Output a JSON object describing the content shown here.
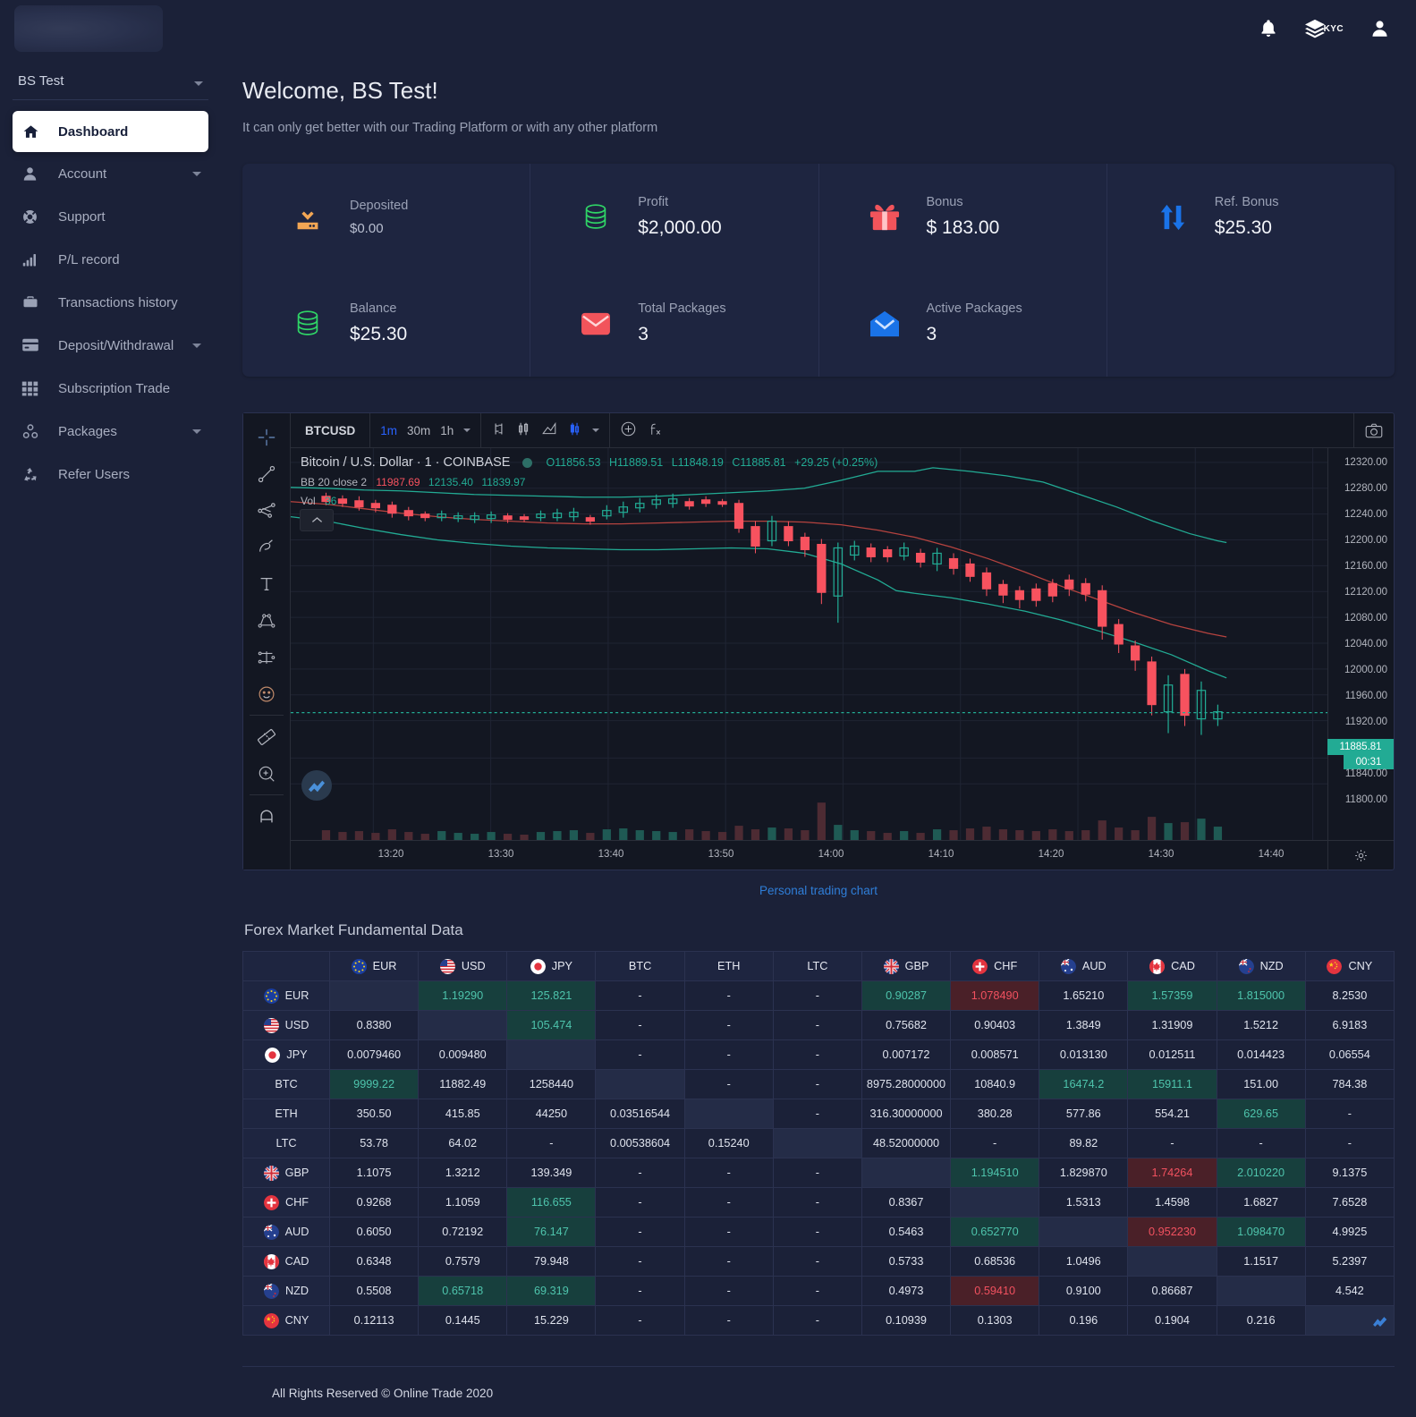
{
  "sidebar": {
    "account_name": "BS Test",
    "items": [
      {
        "label": "Dashboard",
        "icon": "home-icon",
        "active": true,
        "hasArrow": false
      },
      {
        "label": "Account",
        "icon": "user-icon",
        "active": false,
        "hasArrow": true
      },
      {
        "label": "Support",
        "icon": "lifebuoy-icon",
        "active": false,
        "hasArrow": false
      },
      {
        "label": "P/L record",
        "icon": "bar-chart-icon",
        "active": false,
        "hasArrow": false
      },
      {
        "label": "Transactions history",
        "icon": "briefcase-icon",
        "active": false,
        "hasArrow": false
      },
      {
        "label": "Deposit/Withdrawal",
        "icon": "credit-card-icon",
        "active": false,
        "hasArrow": true
      },
      {
        "label": "Subscription Trade",
        "icon": "grid-icon",
        "active": false,
        "hasArrow": false
      },
      {
        "label": "Packages",
        "icon": "packages-icon",
        "active": false,
        "hasArrow": true
      },
      {
        "label": "Refer Users",
        "icon": "recycle-icon",
        "active": false,
        "hasArrow": false
      }
    ]
  },
  "topbar": {
    "menu_icon": "hamburger-icon",
    "notification_icon": "bell-icon",
    "kyc_label": "KYC",
    "kyc_icon": "layers-icon",
    "profile_icon": "user-avatar-icon"
  },
  "header": {
    "welcome": "Welcome, BS Test!",
    "subtitle": "It can only get better with our Trading Platform or with any other platform"
  },
  "stats": [
    {
      "label": "Deposited",
      "value": "$0.00",
      "icon": "download-tray-icon",
      "color": "#f2a654"
    },
    {
      "label": "Balance",
      "value": "$25.30",
      "icon": "coins-icon",
      "color": "#2fd566"
    },
    {
      "label": "Profit",
      "value": "$2,000.00",
      "icon": "coins-icon",
      "color": "#2fd566"
    },
    {
      "label": "Total Packages",
      "value": "3",
      "icon": "envelope-icon",
      "color": "#f2545b"
    },
    {
      "label": "Bonus",
      "value": "$ 183.00",
      "icon": "gift-icon",
      "color": "#f2545b"
    },
    {
      "label": "Active Packages",
      "value": "3",
      "icon": "envelope-open-icon",
      "color": "#1a73e8"
    },
    {
      "label": "Ref. Bonus",
      "value": "$25.30",
      "icon": "repeat-icon",
      "color": "#1a73e8"
    }
  ],
  "chart": {
    "symbol": "BTCUSD",
    "resolutions": [
      "1m",
      "30m",
      "1h"
    ],
    "active_resolution": "1m",
    "toolbar_icons": [
      "compare-icon",
      "candles-icon",
      "area-icon",
      "bar-style-icon",
      "chevron-down-icon",
      "indicator-add-icon",
      "formula-icon"
    ],
    "camera_icon": "camera-icon",
    "left_tools": [
      "crosshair-icon",
      "trendline-icon",
      "pitchfork-icon",
      "brush-icon",
      "text-icon",
      "pattern-icon",
      "position-icon",
      "emoji-icon",
      "ruler-icon",
      "zoom-in-icon",
      "magnet-icon"
    ],
    "legend_title": "Bitcoin / U.S. Dollar · 1 · COINBASE",
    "ohlc": {
      "o_label": "O",
      "o": "11856.53",
      "h_label": "H",
      "h": "11889.51",
      "l_label": "L",
      "l": "11848.19",
      "c_label": "C",
      "c": "11885.81",
      "change": "+29.25 (+0.25%)"
    },
    "bb_label": "BB 20 close 2",
    "bb_v1": "11987.69",
    "bb_v2": "12135.40",
    "bb_v3": "11839.97",
    "vol_label": "Vol",
    "vol_value": "36",
    "last_price": "11885.81",
    "countdown": "00:31",
    "link": "Personal trading chart",
    "settings_icon": "gear-icon",
    "tv_logo_icon": "tradingview-logo-icon",
    "collapse_icon": "chevron-up-icon"
  },
  "chart_data": {
    "type": "line",
    "title": "Bitcoin / U.S. Dollar · 1 · COINBASE",
    "xlabel": "",
    "ylabel": "",
    "ylim": [
      11780,
      12340
    ],
    "y_ticks": [
      "12320.00",
      "12280.00",
      "12240.00",
      "12200.00",
      "12160.00",
      "12120.00",
      "12080.00",
      "12040.00",
      "12000.00",
      "11960.00",
      "11920.00",
      "11840.00",
      "11800.00"
    ],
    "x_ticks": [
      "13:20",
      "13:30",
      "13:40",
      "13:50",
      "14:00",
      "14:10",
      "14:20",
      "14:30",
      "14:40"
    ],
    "grid": true,
    "legend_position": "top-left",
    "series": [
      {
        "name": "BB upper",
        "color": "#22ab94"
      },
      {
        "name": "BB basis",
        "color": "#f7525f"
      },
      {
        "name": "BB lower",
        "color": "#22ab94"
      },
      {
        "name": "Volume",
        "color": "#22ab94/#f7525f"
      }
    ],
    "annotations": [
      {
        "label": "last price",
        "value": "11885.81"
      },
      {
        "label": "countdown",
        "value": "00:31"
      },
      {
        "label": "BB 20 close 2",
        "values": [
          "11987.69",
          "12135.40",
          "11839.97"
        ]
      },
      {
        "label": "Vol",
        "value": "36"
      }
    ]
  },
  "forex": {
    "title": "Forex Market Fundamental Data",
    "columns": [
      {
        "code": "",
        "flag": ""
      },
      {
        "code": "EUR",
        "flag": "eur"
      },
      {
        "code": "USD",
        "flag": "usd"
      },
      {
        "code": "JPY",
        "flag": "jpy"
      },
      {
        "code": "BTC",
        "flag": ""
      },
      {
        "code": "ETH",
        "flag": ""
      },
      {
        "code": "LTC",
        "flag": ""
      },
      {
        "code": "GBP",
        "flag": "gbp"
      },
      {
        "code": "CHF",
        "flag": "chf"
      },
      {
        "code": "AUD",
        "flag": "aud"
      },
      {
        "code": "CAD",
        "flag": "cad"
      },
      {
        "code": "NZD",
        "flag": "nzd"
      },
      {
        "code": "CNY",
        "flag": "cny"
      }
    ],
    "rows": [
      {
        "code": "EUR",
        "flag": "eur",
        "cells": [
          {
            "v": "",
            "s": "diag"
          },
          {
            "v": "1.19290",
            "s": "up"
          },
          {
            "v": "125.821",
            "s": "up"
          },
          {
            "v": "-",
            "s": ""
          },
          {
            "v": "-",
            "s": ""
          },
          {
            "v": "-",
            "s": ""
          },
          {
            "v": "0.90287",
            "s": "up"
          },
          {
            "v": "1.078490",
            "s": "down"
          },
          {
            "v": "1.65210",
            "s": ""
          },
          {
            "v": "1.57359",
            "s": "up"
          },
          {
            "v": "1.815000",
            "s": "up"
          },
          {
            "v": "8.2530",
            "s": ""
          }
        ]
      },
      {
        "code": "USD",
        "flag": "usd",
        "cells": [
          {
            "v": "0.8380",
            "s": ""
          },
          {
            "v": "",
            "s": "diag"
          },
          {
            "v": "105.474",
            "s": "up"
          },
          {
            "v": "-",
            "s": ""
          },
          {
            "v": "-",
            "s": ""
          },
          {
            "v": "-",
            "s": ""
          },
          {
            "v": "0.75682",
            "s": ""
          },
          {
            "v": "0.90403",
            "s": ""
          },
          {
            "v": "1.3849",
            "s": ""
          },
          {
            "v": "1.31909",
            "s": ""
          },
          {
            "v": "1.5212",
            "s": ""
          },
          {
            "v": "6.9183",
            "s": ""
          }
        ]
      },
      {
        "code": "JPY",
        "flag": "jpy",
        "cells": [
          {
            "v": "0.0079460",
            "s": ""
          },
          {
            "v": "0.009480",
            "s": ""
          },
          {
            "v": "",
            "s": "diag"
          },
          {
            "v": "-",
            "s": ""
          },
          {
            "v": "-",
            "s": ""
          },
          {
            "v": "-",
            "s": ""
          },
          {
            "v": "0.007172",
            "s": ""
          },
          {
            "v": "0.008571",
            "s": ""
          },
          {
            "v": "0.013130",
            "s": ""
          },
          {
            "v": "0.012511",
            "s": ""
          },
          {
            "v": "0.014423",
            "s": ""
          },
          {
            "v": "0.06554",
            "s": ""
          }
        ]
      },
      {
        "code": "BTC",
        "flag": "",
        "cells": [
          {
            "v": "9999.22",
            "s": "up"
          },
          {
            "v": "11882.49",
            "s": ""
          },
          {
            "v": "1258440",
            "s": ""
          },
          {
            "v": "",
            "s": "diag"
          },
          {
            "v": "-",
            "s": ""
          },
          {
            "v": "-",
            "s": ""
          },
          {
            "v": "8975.28000000",
            "s": ""
          },
          {
            "v": "10840.9",
            "s": ""
          },
          {
            "v": "16474.2",
            "s": "up"
          },
          {
            "v": "15911.1",
            "s": "up"
          },
          {
            "v": "151.00",
            "s": ""
          },
          {
            "v": "784.38",
            "s": ""
          }
        ]
      },
      {
        "code": "ETH",
        "flag": "",
        "cells": [
          {
            "v": "350.50",
            "s": ""
          },
          {
            "v": "415.85",
            "s": ""
          },
          {
            "v": "44250",
            "s": ""
          },
          {
            "v": "0.03516544",
            "s": ""
          },
          {
            "v": "",
            "s": "diag"
          },
          {
            "v": "-",
            "s": ""
          },
          {
            "v": "316.30000000",
            "s": ""
          },
          {
            "v": "380.28",
            "s": ""
          },
          {
            "v": "577.86",
            "s": ""
          },
          {
            "v": "554.21",
            "s": ""
          },
          {
            "v": "629.65",
            "s": "up"
          },
          {
            "v": "-",
            "s": ""
          }
        ]
      },
      {
        "code": "LTC",
        "flag": "",
        "cells": [
          {
            "v": "53.78",
            "s": ""
          },
          {
            "v": "64.02",
            "s": ""
          },
          {
            "v": "-",
            "s": ""
          },
          {
            "v": "0.00538604",
            "s": ""
          },
          {
            "v": "0.15240",
            "s": ""
          },
          {
            "v": "",
            "s": "diag"
          },
          {
            "v": "48.52000000",
            "s": ""
          },
          {
            "v": "-",
            "s": ""
          },
          {
            "v": "89.82",
            "s": ""
          },
          {
            "v": "-",
            "s": ""
          },
          {
            "v": "-",
            "s": ""
          },
          {
            "v": "-",
            "s": ""
          }
        ]
      },
      {
        "code": "GBP",
        "flag": "gbp",
        "cells": [
          {
            "v": "1.1075",
            "s": ""
          },
          {
            "v": "1.3212",
            "s": ""
          },
          {
            "v": "139.349",
            "s": ""
          },
          {
            "v": "-",
            "s": ""
          },
          {
            "v": "-",
            "s": ""
          },
          {
            "v": "-",
            "s": ""
          },
          {
            "v": "",
            "s": "diag"
          },
          {
            "v": "1.194510",
            "s": "up"
          },
          {
            "v": "1.829870",
            "s": ""
          },
          {
            "v": "1.74264",
            "s": "down"
          },
          {
            "v": "2.010220",
            "s": "up"
          },
          {
            "v": "9.1375",
            "s": ""
          }
        ]
      },
      {
        "code": "CHF",
        "flag": "chf",
        "cells": [
          {
            "v": "0.9268",
            "s": ""
          },
          {
            "v": "1.1059",
            "s": ""
          },
          {
            "v": "116.655",
            "s": "up"
          },
          {
            "v": "-",
            "s": ""
          },
          {
            "v": "-",
            "s": ""
          },
          {
            "v": "-",
            "s": ""
          },
          {
            "v": "0.8367",
            "s": ""
          },
          {
            "v": "",
            "s": "diag"
          },
          {
            "v": "1.5313",
            "s": ""
          },
          {
            "v": "1.4598",
            "s": ""
          },
          {
            "v": "1.6827",
            "s": ""
          },
          {
            "v": "7.6528",
            "s": ""
          }
        ]
      },
      {
        "code": "AUD",
        "flag": "aud",
        "cells": [
          {
            "v": "0.6050",
            "s": ""
          },
          {
            "v": "0.72192",
            "s": ""
          },
          {
            "v": "76.147",
            "s": "up"
          },
          {
            "v": "-",
            "s": ""
          },
          {
            "v": "-",
            "s": ""
          },
          {
            "v": "-",
            "s": ""
          },
          {
            "v": "0.5463",
            "s": ""
          },
          {
            "v": "0.652770",
            "s": "up"
          },
          {
            "v": "",
            "s": "diag"
          },
          {
            "v": "0.952230",
            "s": "down"
          },
          {
            "v": "1.098470",
            "s": "up"
          },
          {
            "v": "4.9925",
            "s": ""
          }
        ]
      },
      {
        "code": "CAD",
        "flag": "cad",
        "cells": [
          {
            "v": "0.6348",
            "s": ""
          },
          {
            "v": "0.7579",
            "s": ""
          },
          {
            "v": "79.948",
            "s": ""
          },
          {
            "v": "-",
            "s": ""
          },
          {
            "v": "-",
            "s": ""
          },
          {
            "v": "-",
            "s": ""
          },
          {
            "v": "0.5733",
            "s": ""
          },
          {
            "v": "0.68536",
            "s": ""
          },
          {
            "v": "1.0496",
            "s": ""
          },
          {
            "v": "",
            "s": "diag"
          },
          {
            "v": "1.1517",
            "s": ""
          },
          {
            "v": "5.2397",
            "s": ""
          }
        ]
      },
      {
        "code": "NZD",
        "flag": "nzd",
        "cells": [
          {
            "v": "0.5508",
            "s": ""
          },
          {
            "v": "0.65718",
            "s": "up"
          },
          {
            "v": "69.319",
            "s": "up"
          },
          {
            "v": "-",
            "s": ""
          },
          {
            "v": "-",
            "s": ""
          },
          {
            "v": "-",
            "s": ""
          },
          {
            "v": "0.4973",
            "s": ""
          },
          {
            "v": "0.59410",
            "s": "down"
          },
          {
            "v": "0.9100",
            "s": ""
          },
          {
            "v": "0.86687",
            "s": ""
          },
          {
            "v": "",
            "s": "diag"
          },
          {
            "v": "4.542",
            "s": ""
          }
        ]
      },
      {
        "code": "CNY",
        "flag": "cny",
        "cells": [
          {
            "v": "0.12113",
            "s": ""
          },
          {
            "v": "0.1445",
            "s": ""
          },
          {
            "v": "15.229",
            "s": ""
          },
          {
            "v": "-",
            "s": ""
          },
          {
            "v": "-",
            "s": ""
          },
          {
            "v": "-",
            "s": ""
          },
          {
            "v": "0.10939",
            "s": ""
          },
          {
            "v": "0.1303",
            "s": ""
          },
          {
            "v": "0.196",
            "s": ""
          },
          {
            "v": "0.1904",
            "s": ""
          },
          {
            "v": "0.216",
            "s": ""
          },
          {
            "v": "",
            "s": "diag"
          }
        ]
      }
    ]
  },
  "footer": {
    "text": "All Rights Reserved © Online Trade 2020"
  },
  "colors": {
    "bg": "#1b2138",
    "card": "#1e2540",
    "accent_blue": "#2f7ed8",
    "green": "#22ab94",
    "red": "#f7525f",
    "chart_bg": "#131722"
  }
}
